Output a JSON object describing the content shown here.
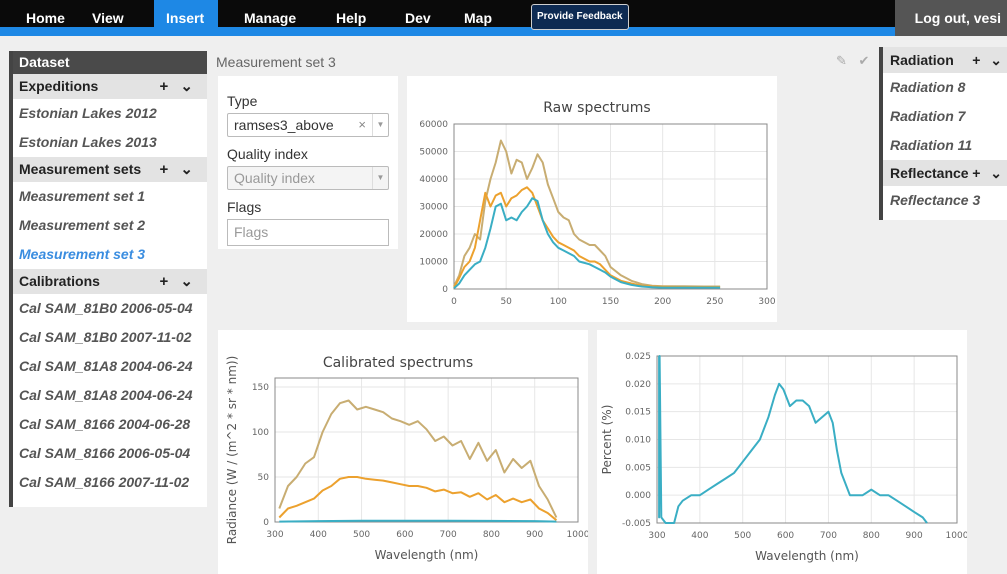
{
  "nav": {
    "items": [
      {
        "label": "Home",
        "active": false
      },
      {
        "label": "View",
        "active": false
      },
      {
        "label": "Insert",
        "active": true
      },
      {
        "label": "Manage",
        "active": false
      },
      {
        "label": "Help",
        "active": false
      },
      {
        "label": "Dev",
        "active": false
      },
      {
        "label": "Map",
        "active": false
      }
    ],
    "feedback_label": "Provide Feedback",
    "logout_label": "Log out, vesi"
  },
  "sidebar": {
    "header": "Dataset",
    "controls": "+ ⌄",
    "expeditions": {
      "label": "Expeditions",
      "items": [
        "Estonian Lakes 2012",
        "Estonian Lakes 2013"
      ]
    },
    "measurement_sets": {
      "label": "Measurement sets",
      "items": [
        "Measurement set 1",
        "Measurement set 2",
        "Measurement set 3"
      ],
      "active_index": 2
    },
    "calibrations": {
      "label": "Calibrations",
      "items": [
        "Cal SAM_81B0 2006-05-04",
        "Cal SAM_81B0 2007-11-02",
        "Cal SAM_81A8 2004-06-24",
        "Cal SAM_81A8 2004-06-24",
        "Cal SAM_8166 2004-06-28",
        "Cal SAM_8166 2006-05-04",
        "Cal SAM_8166 2007-11-02"
      ]
    }
  },
  "main": {
    "title": "Measurement set 3",
    "actions": "✎ ✔"
  },
  "form": {
    "type_label": "Type",
    "type_value": "ramses3_above",
    "clear_glyph": "×",
    "quality_label": "Quality index",
    "quality_placeholder": "Quality index",
    "flags_label": "Flags",
    "flags_placeholder": "Flags"
  },
  "right_sidebar": {
    "radiation": {
      "label": "Radiation",
      "items": [
        "Radiation 8",
        "Radiation 7",
        "Radiation 11"
      ]
    },
    "reflectance": {
      "label": "Reflectance",
      "items": [
        "Reflectance 3"
      ]
    },
    "controls": "+ ⌄"
  },
  "colors": {
    "accent": "#1e88e5",
    "series_tan": "#c8ad72",
    "series_orange": "#eca12e",
    "series_teal": "#3aaec4"
  },
  "chart_data": [
    {
      "type": "line",
      "title": "Raw spectrums",
      "xlabel": "",
      "ylabel": "",
      "xlim": [
        0,
        300
      ],
      "ylim": [
        0,
        60000
      ],
      "xticks": [
        0,
        50,
        100,
        150,
        200,
        250,
        300
      ],
      "yticks": [
        0,
        10000,
        20000,
        30000,
        40000,
        50000,
        60000
      ],
      "grid": true,
      "series": [
        {
          "color": "#c8ad72",
          "x": [
            0,
            5,
            10,
            15,
            20,
            25,
            30,
            35,
            40,
            45,
            50,
            55,
            60,
            65,
            70,
            75,
            80,
            85,
            90,
            95,
            100,
            105,
            110,
            115,
            120,
            125,
            130,
            135,
            140,
            145,
            150,
            160,
            170,
            180,
            190,
            200,
            220,
            240,
            255
          ],
          "values": [
            1000,
            5000,
            12000,
            15000,
            20000,
            18000,
            32000,
            40000,
            46000,
            54000,
            50000,
            42000,
            47000,
            46000,
            40000,
            44000,
            49000,
            46000,
            38000,
            33000,
            28000,
            26000,
            25000,
            20000,
            18000,
            17000,
            16000,
            16000,
            14000,
            12000,
            8000,
            5000,
            3000,
            1800,
            1200,
            1000,
            1000,
            900,
            900
          ]
        },
        {
          "color": "#eca12e",
          "x": [
            0,
            5,
            10,
            15,
            20,
            25,
            30,
            35,
            40,
            45,
            50,
            55,
            60,
            65,
            70,
            75,
            80,
            85,
            90,
            95,
            100,
            105,
            110,
            115,
            120,
            125,
            130,
            135,
            140,
            145,
            150,
            160,
            170,
            180,
            190,
            200,
            220,
            240,
            255
          ],
          "values": [
            500,
            4000,
            8000,
            10000,
            15000,
            25000,
            35000,
            30000,
            34000,
            35000,
            30000,
            33000,
            34000,
            36000,
            37000,
            35000,
            30000,
            25000,
            22000,
            19000,
            17000,
            16000,
            15000,
            14000,
            12000,
            11000,
            10000,
            10000,
            9000,
            7000,
            5000,
            3000,
            2000,
            1200,
            900,
            800,
            700,
            700,
            700
          ]
        },
        {
          "color": "#3aaec4",
          "x": [
            0,
            5,
            10,
            15,
            20,
            25,
            30,
            35,
            40,
            45,
            50,
            55,
            60,
            65,
            70,
            75,
            80,
            85,
            90,
            95,
            100,
            105,
            110,
            115,
            120,
            125,
            130,
            135,
            140,
            145,
            150,
            160,
            170,
            180,
            190,
            200,
            220,
            240,
            255
          ],
          "values": [
            300,
            2000,
            5000,
            7000,
            9000,
            10000,
            15000,
            22000,
            30000,
            31000,
            25000,
            26000,
            25000,
            28000,
            30000,
            33000,
            32000,
            25000,
            20000,
            17000,
            15000,
            14000,
            13000,
            12000,
            10000,
            9500,
            9000,
            8000,
            7000,
            6000,
            4500,
            2500,
            1500,
            900,
            600,
            500,
            500,
            500,
            500
          ]
        }
      ]
    },
    {
      "type": "line",
      "title": "Calibrated spectrums",
      "xlabel": "Wavelength (nm)",
      "ylabel": "Radiance (W / (m^2 * sr * nm))",
      "xlim": [
        300,
        1000
      ],
      "ylim": [
        0,
        160
      ],
      "xticks": [
        300,
        400,
        500,
        600,
        700,
        800,
        900,
        1000
      ],
      "yticks": [
        0,
        50,
        100,
        150
      ],
      "grid": true,
      "series": [
        {
          "color": "#c8ad72",
          "x": [
            310,
            330,
            350,
            370,
            390,
            410,
            430,
            450,
            470,
            490,
            510,
            530,
            550,
            570,
            590,
            610,
            630,
            650,
            670,
            690,
            710,
            730,
            750,
            770,
            790,
            810,
            830,
            850,
            870,
            890,
            910,
            930,
            950
          ],
          "values": [
            15,
            40,
            50,
            65,
            72,
            100,
            120,
            132,
            135,
            125,
            128,
            125,
            122,
            115,
            112,
            108,
            112,
            103,
            90,
            95,
            85,
            90,
            70,
            88,
            68,
            80,
            55,
            70,
            60,
            68,
            40,
            25,
            5
          ]
        },
        {
          "color": "#eca12e",
          "x": [
            310,
            330,
            350,
            370,
            390,
            410,
            430,
            450,
            470,
            490,
            510,
            530,
            550,
            570,
            590,
            610,
            630,
            650,
            670,
            690,
            710,
            730,
            750,
            770,
            790,
            810,
            830,
            850,
            870,
            890,
            910,
            930,
            950
          ],
          "values": [
            5,
            15,
            18,
            22,
            26,
            35,
            40,
            48,
            50,
            50,
            48,
            47,
            46,
            44,
            42,
            40,
            40,
            38,
            34,
            36,
            32,
            33,
            28,
            32,
            25,
            30,
            22,
            26,
            22,
            25,
            15,
            10,
            2
          ]
        },
        {
          "color": "#3aaec4",
          "x": [
            310,
            400,
            500,
            600,
            700,
            800,
            900,
            950
          ],
          "values": [
            0.5,
            1,
            1.5,
            1.5,
            1.5,
            1.2,
            1,
            0.5
          ]
        }
      ]
    },
    {
      "type": "line",
      "title": "",
      "xlabel": "Wavelength (nm)",
      "ylabel": "Percent (%)",
      "xlim": [
        300,
        1000
      ],
      "ylim": [
        -0.005,
        0.025
      ],
      "xticks": [
        300,
        400,
        500,
        600,
        700,
        800,
        900,
        1000
      ],
      "yticks": [
        -0.005,
        0.0,
        0.005,
        0.01,
        0.015,
        0.02,
        0.025
      ],
      "grid": true,
      "series": [
        {
          "color": "#3aaec4",
          "x": [
            305,
            305,
            306,
            310,
            320,
            330,
            340,
            350,
            360,
            380,
            400,
            420,
            440,
            460,
            480,
            500,
            520,
            540,
            560,
            575,
            585,
            595,
            610,
            625,
            640,
            655,
            670,
            685,
            700,
            710,
            720,
            730,
            740,
            750,
            760,
            780,
            800,
            820,
            840,
            860,
            880,
            900,
            920,
            930
          ],
          "values": [
            0.025,
            -0.004,
            0.025,
            -0.004,
            -0.006,
            -0.006,
            -0.005,
            -0.002,
            -0.001,
            0.0,
            0.0,
            0.001,
            0.002,
            0.003,
            0.004,
            0.006,
            0.008,
            0.01,
            0.014,
            0.018,
            0.02,
            0.019,
            0.016,
            0.017,
            0.017,
            0.016,
            0.013,
            0.014,
            0.015,
            0.013,
            0.008,
            0.004,
            0.002,
            0.0,
            0.0,
            0.0,
            0.001,
            0.0,
            0.0,
            -0.001,
            -0.002,
            -0.003,
            -0.004,
            -0.005
          ]
        }
      ]
    }
  ]
}
